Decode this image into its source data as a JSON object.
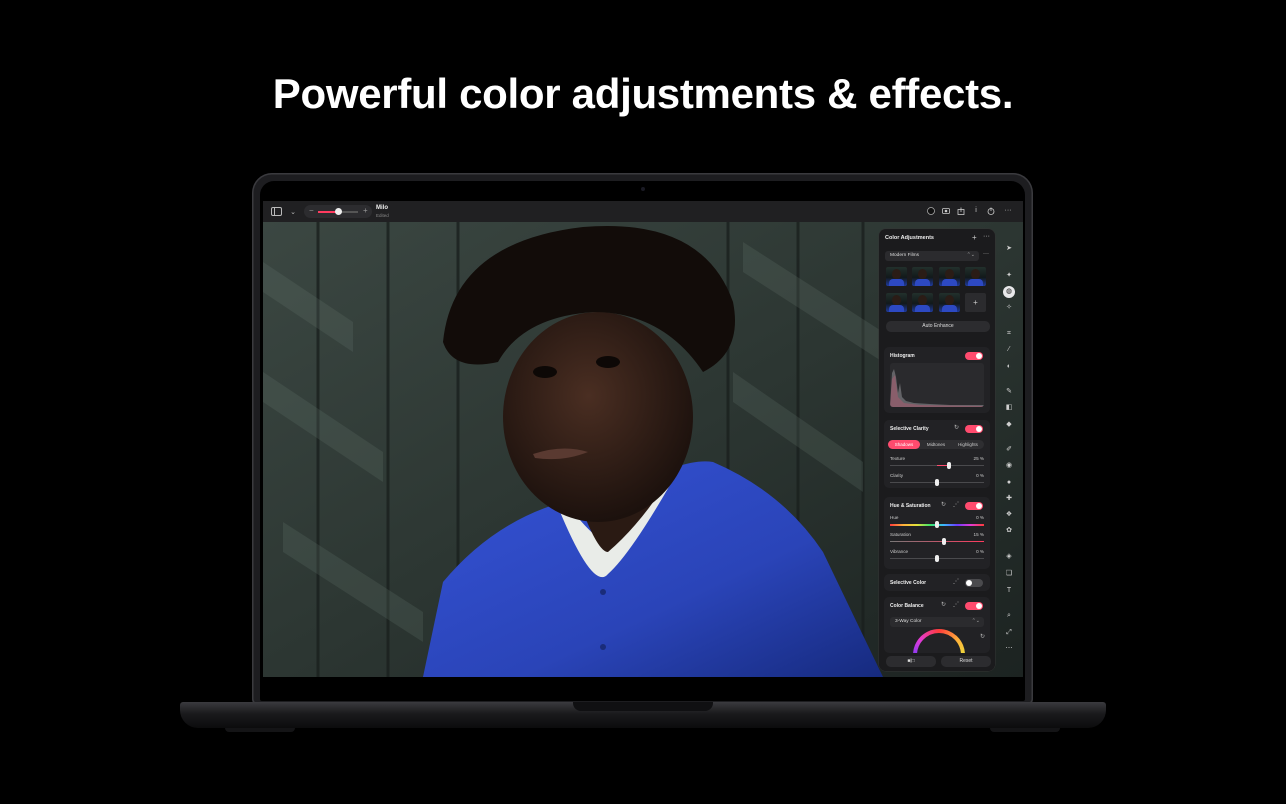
{
  "headline": "Powerful color adjustments & effects.",
  "toolbar": {
    "sidebar_icon": "sidebar-icon",
    "chevron": "⌄",
    "zoom_minus": "−",
    "zoom_plus": "+",
    "zoom_level": 0.5,
    "document_title": "Milo",
    "document_subtitle": "Edited",
    "right_icons": [
      "color-dot-icon",
      "photo-icon",
      "share-icon",
      "info-icon",
      "export-icon",
      "more-icon"
    ]
  },
  "panel": {
    "title": "Color Adjustments",
    "add": "+",
    "more": "···",
    "preset_select": "Modern Films",
    "preset_select_arrows": "⌃⌄",
    "preset_add": "+",
    "auto_enhance": "Auto Enhance",
    "histogram": {
      "title": "Histogram",
      "enabled": true
    },
    "selective_clarity": {
      "title": "Selective Clarity",
      "enabled": true,
      "tabs": [
        "Shadows",
        "Midtones",
        "Highlights"
      ],
      "active_tab": "Shadows",
      "texture_label": "Texture",
      "texture_value": "25 %",
      "texture": 25,
      "clarity_label": "Clarity",
      "clarity_value": "0 %",
      "clarity": 0
    },
    "hue_saturation": {
      "title": "Hue & Saturation",
      "enabled": true,
      "hue_label": "Hue",
      "hue_value": "0 %",
      "hue": 0,
      "saturation_label": "Saturation",
      "saturation_value": "15 %",
      "saturation": 15,
      "vibrance_label": "Vibrance",
      "vibrance_value": "0 %",
      "vibrance": 0
    },
    "selective_color": {
      "title": "Selective Color",
      "enabled": false
    },
    "color_balance": {
      "title": "Color Balance",
      "enabled": true,
      "mode": "3-Way Color",
      "mode_arrows": "⌃⌄"
    },
    "compare": "■|□",
    "reset": "Reset"
  },
  "tools": [
    "pointer-icon",
    "paint-icon",
    "color-adjust-icon",
    "star-icon",
    "crop-select-icon",
    "magic-wand-icon",
    "blend-icon",
    "brush-icon",
    "eraser-fill-icon",
    "fill-icon",
    "pencil-icon",
    "gradient-icon",
    "clone-icon",
    "heal-icon",
    "retouch-icon",
    "smudge-icon",
    "shape-fill-icon",
    "layers-icon",
    "text-icon",
    "zoom-icon",
    "transform-icon",
    "more-icon"
  ],
  "colors": {
    "accent": "#ff4b6e",
    "panel": "#1b1b1d",
    "background": "#000000",
    "sweater": "#2d49c2",
    "wall": "#2a332f"
  }
}
